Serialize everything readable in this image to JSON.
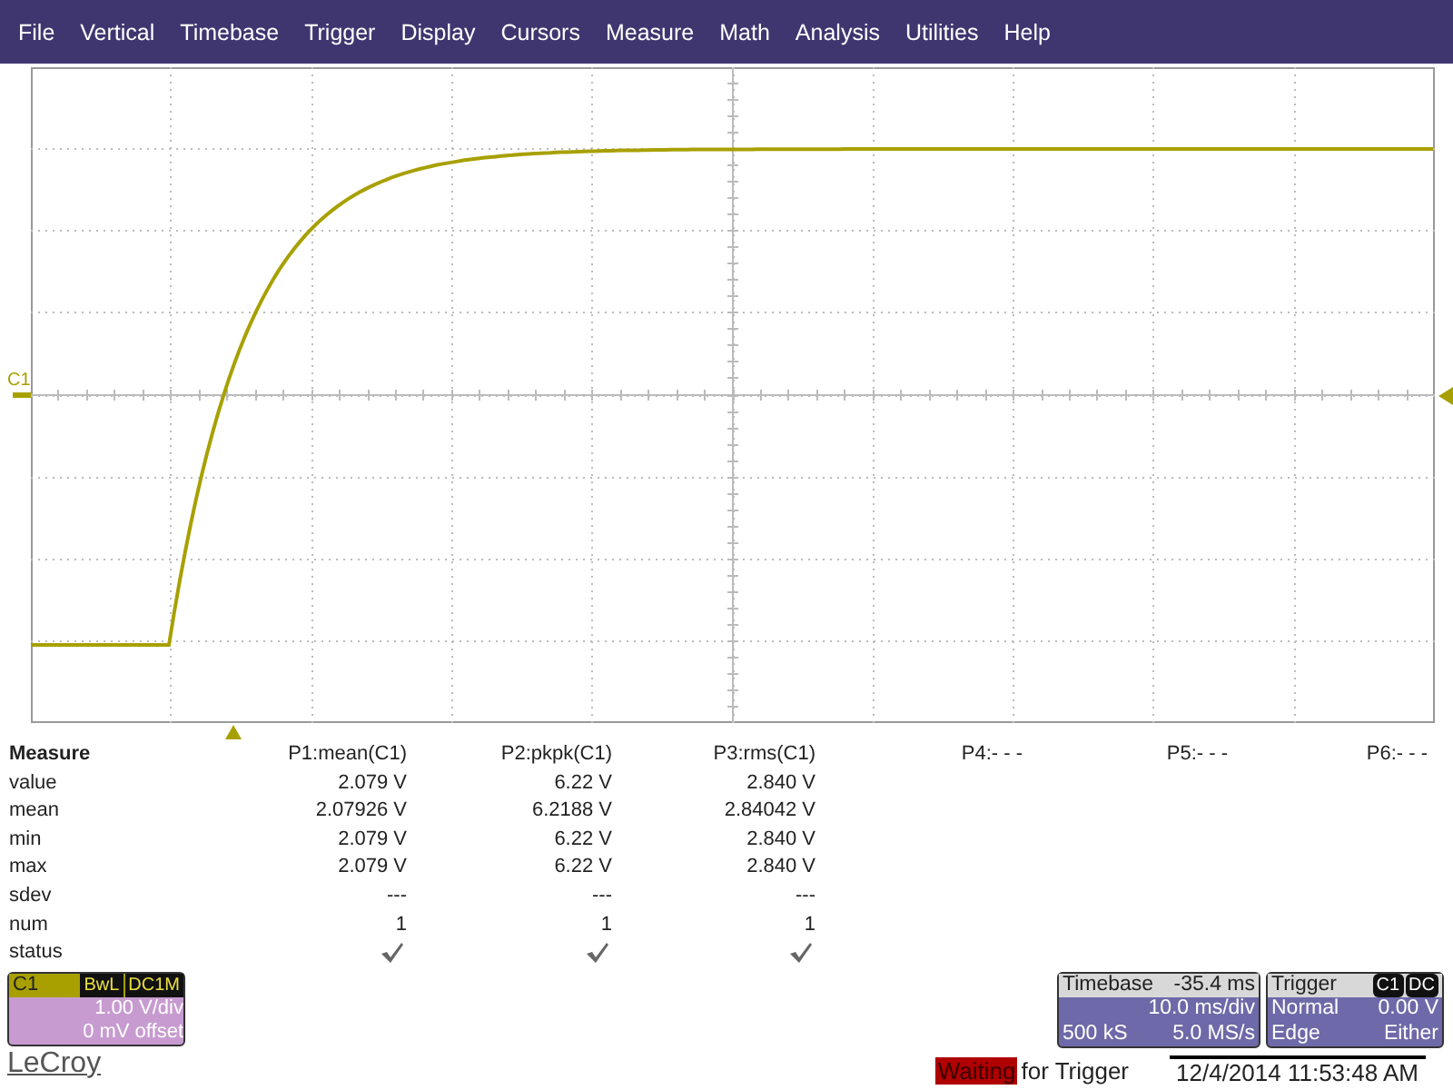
{
  "menu": [
    "File",
    "Vertical",
    "Timebase",
    "Trigger",
    "Display",
    "Cursors",
    "Measure",
    "Math",
    "Analysis",
    "Utilities",
    "Help"
  ],
  "display": {
    "channel_marker": "C1"
  },
  "measure": {
    "title": "Measure",
    "row_labels": [
      "value",
      "mean",
      "min",
      "max",
      "sdev",
      "num",
      "status"
    ],
    "params": [
      {
        "header": "P1:mean(C1)",
        "cells": [
          "2.079 V",
          "2.07926 V",
          "2.079 V",
          "2.079 V",
          "---",
          "1"
        ],
        "status_ok": true
      },
      {
        "header": "P2:pkpk(C1)",
        "cells": [
          "6.22 V",
          "6.2188 V",
          "6.22 V",
          "6.22 V",
          "---",
          "1"
        ],
        "status_ok": true
      },
      {
        "header": "P3:rms(C1)",
        "cells": [
          "2.840 V",
          "2.84042 V",
          "2.840 V",
          "2.840 V",
          "---",
          "1"
        ],
        "status_ok": true
      },
      {
        "header": "P4:- - -"
      },
      {
        "header": "P5:- - -"
      },
      {
        "header": "P6:- - -"
      }
    ]
  },
  "channel": {
    "name": "C1",
    "badges": [
      "BwL",
      "DC1M"
    ],
    "scale": "1.00 V/div",
    "offset": "0 mV offset"
  },
  "brand": "LeCroy",
  "timebase": {
    "label": "Timebase",
    "delay": "-35.4 ms",
    "scale": "10.0 ms/div",
    "samples": "500 kS",
    "rate": "5.0 MS/s"
  },
  "trigger": {
    "label": "Trigger",
    "badges": [
      "C1",
      "DC"
    ],
    "mode": "Normal",
    "level": "0.00 V",
    "type": "Edge",
    "slope": "Either"
  },
  "status": {
    "state": "Waiting",
    "text": "for Trigger",
    "datetime": "12/4/2014 11:53:48 AM"
  }
}
